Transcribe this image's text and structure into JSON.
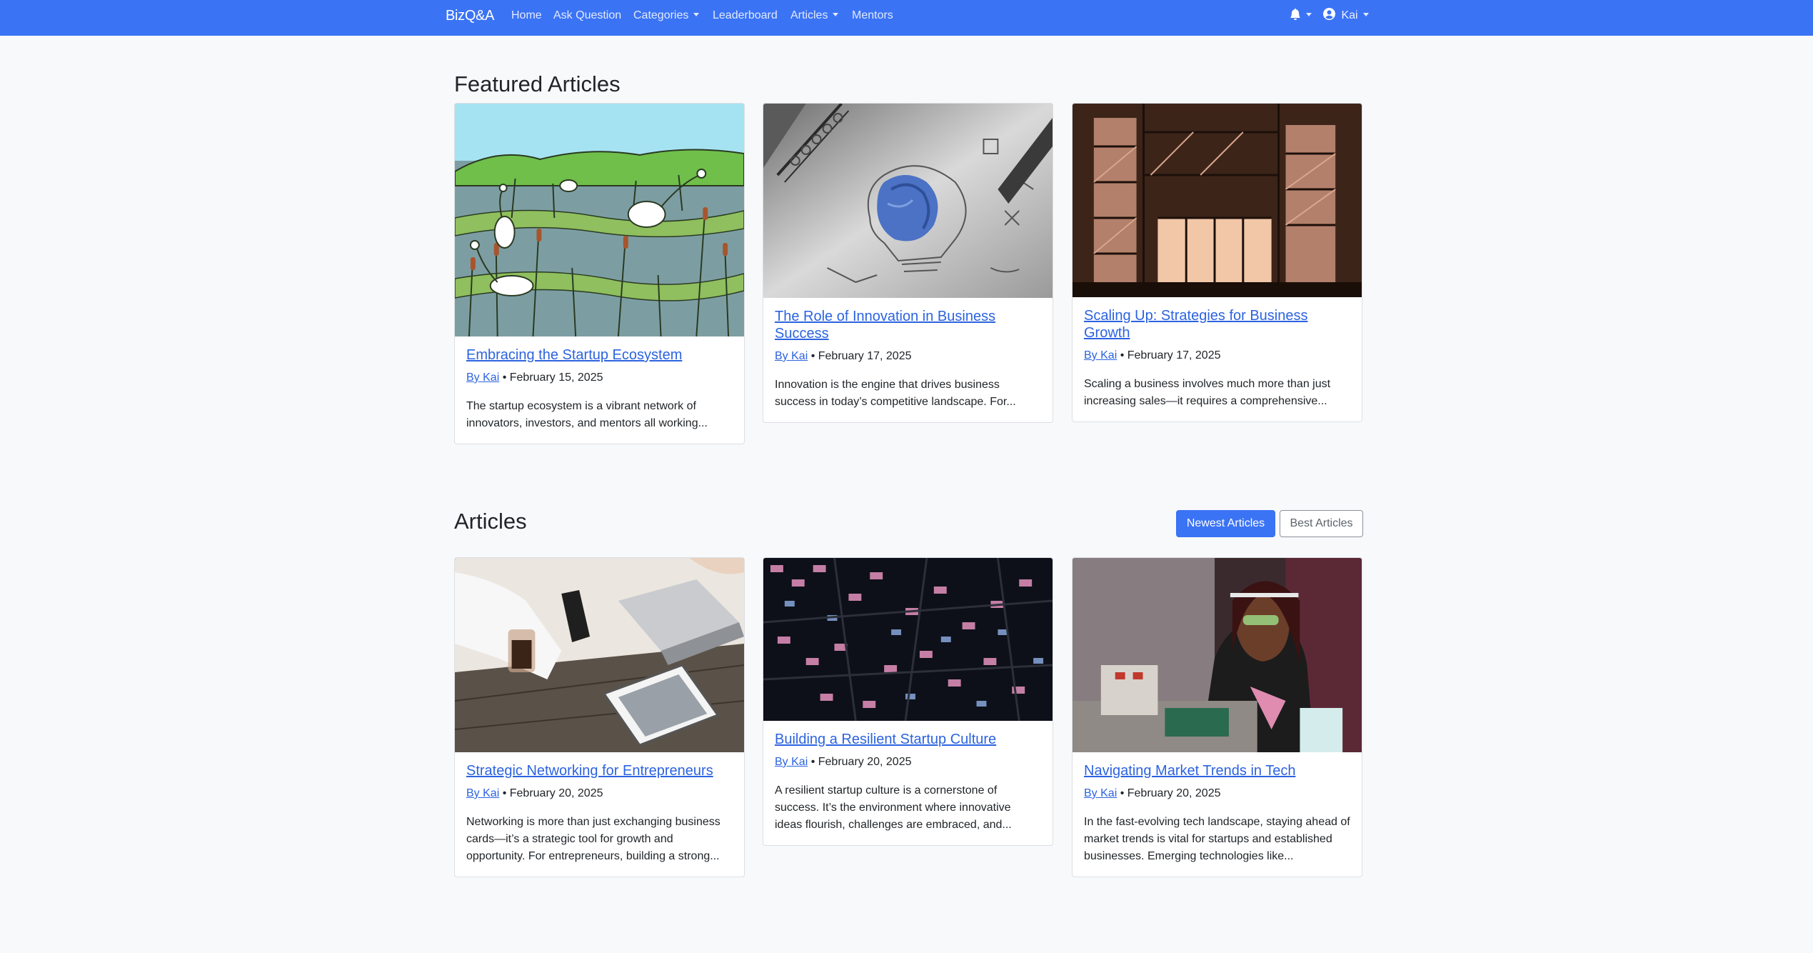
{
  "navbar": {
    "brand": "BizQ&A",
    "links": {
      "home": "Home",
      "ask": "Ask Question",
      "categories": "Categories",
      "leaderboard": "Leaderboard",
      "articles": "Articles",
      "mentors": "Mentors"
    },
    "user": "Kai"
  },
  "featured": {
    "title": "Featured Articles",
    "cards": [
      {
        "title": "Embracing the Startup Ecosystem",
        "author": "By Kai",
        "date": "February 15, 2025",
        "excerpt": "The startup ecosystem is a vibrant network of innovators, investors, and mentors all working..."
      },
      {
        "title": "The Role of Innovation in Business Success",
        "author": "By Kai",
        "date": "February 17, 2025",
        "excerpt": "Innovation is the engine that drives business success in today’s competitive landscape. For..."
      },
      {
        "title": "Scaling Up: Strategies for Business Growth",
        "author": "By Kai",
        "date": "February 17, 2025",
        "excerpt": "Scaling a business involves much more than just increasing sales—it requires a comprehensive..."
      }
    ]
  },
  "articles": {
    "title": "Articles",
    "newest_label": "Newest Articles",
    "best_label": "Best Articles",
    "cards": [
      {
        "title": "Strategic Networking for Entrepreneurs",
        "author": "By Kai",
        "date": "February 20, 2025",
        "excerpt": "Networking is more than just exchanging business cards—it’s a strategic tool for growth and opportunity. For entrepreneurs, building a strong..."
      },
      {
        "title": "Building a Resilient Startup Culture",
        "author": "By Kai",
        "date": "February 20, 2025",
        "excerpt": "A resilient startup culture is a cornerstone of success. It’s the environment where innovative ideas flourish, challenges are embraced, and..."
      },
      {
        "title": "Navigating Market Trends in Tech",
        "author": "By Kai",
        "date": "February 20, 2025",
        "excerpt": "In the fast-evolving tech landscape, staying ahead of market trends is vital for startups and established businesses. Emerging technologies like..."
      }
    ]
  },
  "meta_separator": " • ",
  "colors": {
    "primary": "#3b73f5",
    "link": "#2c63e0",
    "background": "#f8f9fa"
  }
}
